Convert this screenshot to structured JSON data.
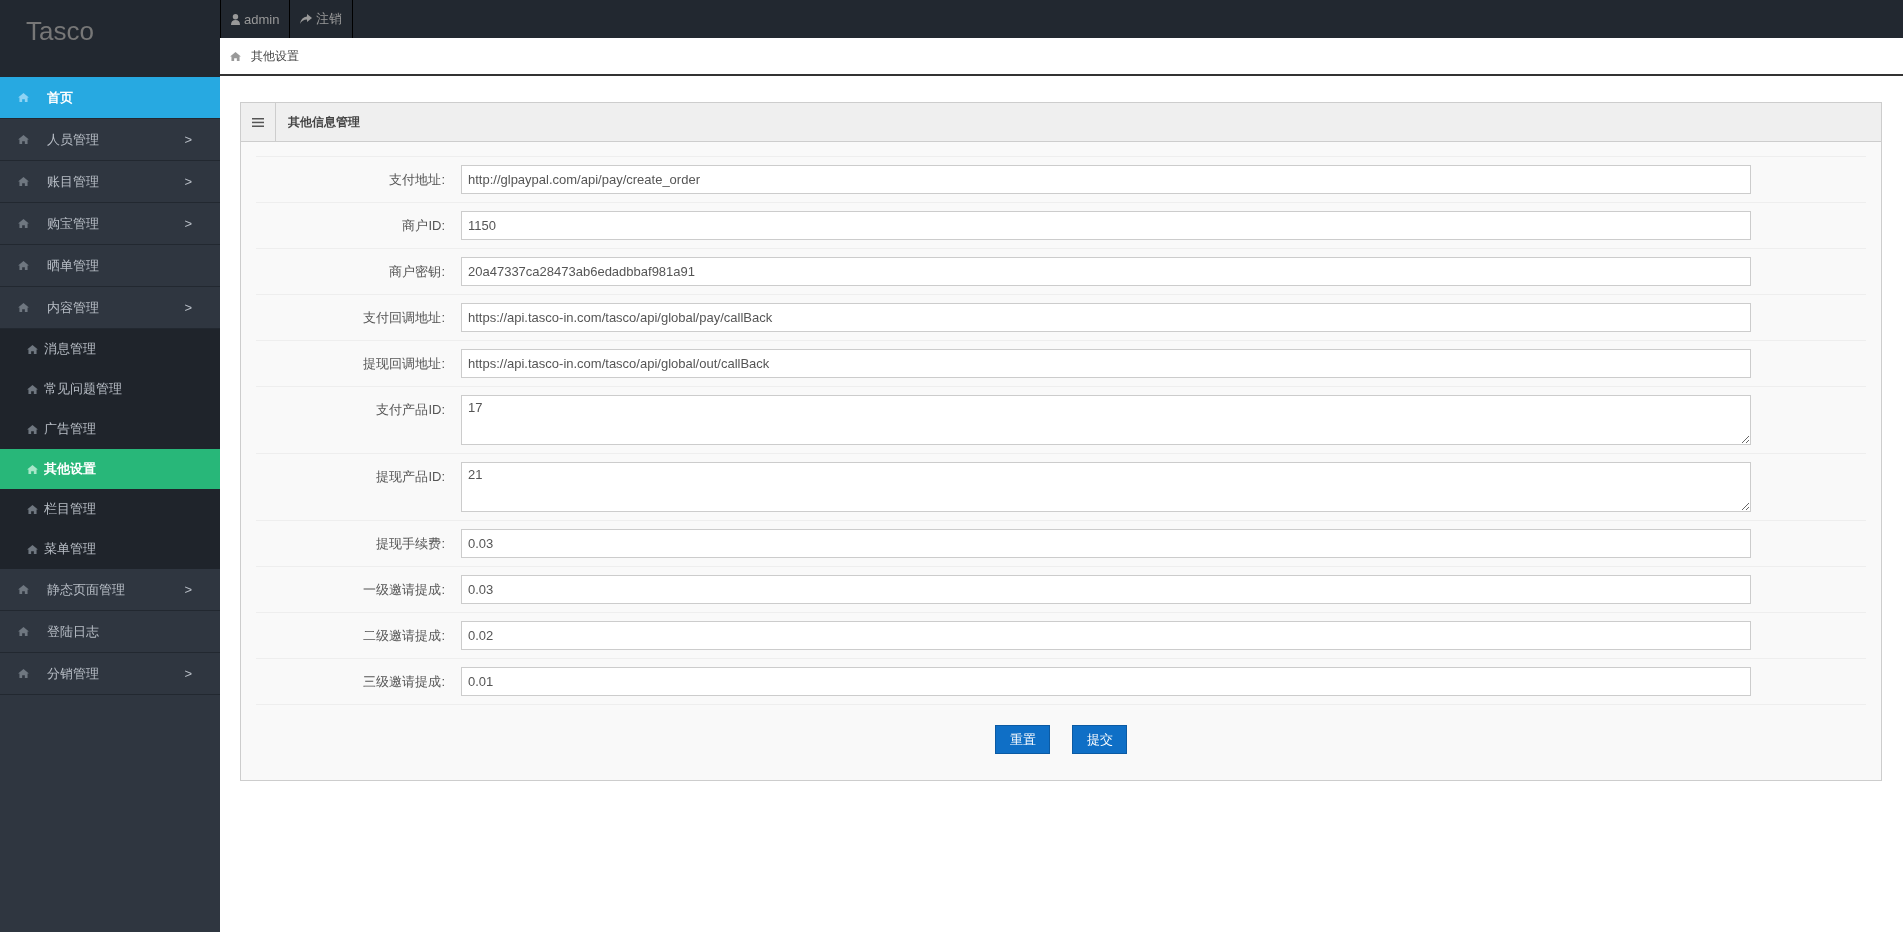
{
  "logo": "Tasco",
  "topbar": [
    {
      "kind": "user",
      "label": "admin"
    },
    {
      "kind": "logout",
      "label": "注销"
    }
  ],
  "breadcrumb": "其他设置",
  "sidebar": {
    "items": [
      {
        "label": "首页",
        "selected": true
      },
      {
        "label": "人员管理",
        "selected": false,
        "arrow": ">"
      },
      {
        "label": "账目管理",
        "selected": false,
        "arrow": ">"
      },
      {
        "label": "购宝管理",
        "selected": false,
        "arrow": ">"
      },
      {
        "label": "晒单管理",
        "selected": false
      },
      {
        "label": "内容管理",
        "selected": false,
        "arrow": ">",
        "expanded": true,
        "children": [
          {
            "label": "消息管理",
            "selected": false
          },
          {
            "label": "常见问题管理",
            "selected": false
          },
          {
            "label": "广告管理",
            "selected": false
          },
          {
            "label": "其他设置",
            "selected": true
          },
          {
            "label": "栏目管理",
            "selected": false
          },
          {
            "label": "菜单管理",
            "selected": false
          }
        ]
      },
      {
        "label": "静态页面管理",
        "selected": false,
        "arrow": ">"
      },
      {
        "label": "登陆日志",
        "selected": false
      },
      {
        "label": "分销管理",
        "selected": false,
        "arrow": ">"
      }
    ]
  },
  "panel": {
    "title": "其他信息管理",
    "fields": [
      {
        "label": "支付地址:",
        "kind": "input",
        "value": "http://glpaypal.com/api/pay/create_order"
      },
      {
        "label": "商户ID:",
        "kind": "input",
        "value": "1150"
      },
      {
        "label": "商户密钥:",
        "kind": "input",
        "value": "20a47337ca28473ab6edadbbaf981a91"
      },
      {
        "label": "支付回调地址:",
        "kind": "input",
        "value": "https://api.tasco-in.com/tasco/api/global/pay/callBack"
      },
      {
        "label": "提现回调地址:",
        "kind": "input",
        "value": "https://api.tasco-in.com/tasco/api/global/out/callBack"
      },
      {
        "label": "支付产品ID:",
        "kind": "textarea",
        "value": "17"
      },
      {
        "label": "提现产品ID:",
        "kind": "textarea",
        "value": "21"
      },
      {
        "label": "提现手续费:",
        "kind": "input",
        "value": "0.03"
      },
      {
        "label": "一级邀请提成:",
        "kind": "input",
        "value": "0.03"
      },
      {
        "label": "二级邀请提成:",
        "kind": "input",
        "value": "0.02"
      },
      {
        "label": "三级邀请提成:",
        "kind": "input",
        "value": "0.01"
      }
    ],
    "buttons": [
      "重置",
      "提交"
    ]
  }
}
